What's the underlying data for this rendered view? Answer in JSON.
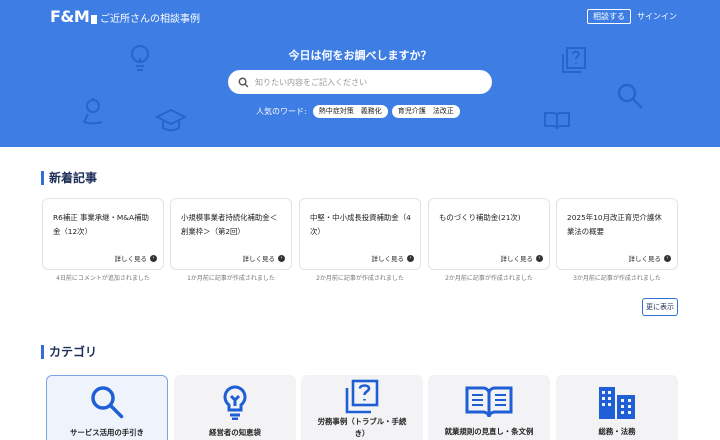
{
  "header": {
    "logo_text": "F&M",
    "site_title": "ご近所さんの相談事例",
    "consult_label": "相談する",
    "signin_label": "サインイン"
  },
  "hero": {
    "heading": "今日は何をお調べしますか？",
    "search_placeholder": "知りたい内容をご記入ください",
    "popular_label": "人気のワード:",
    "popular_tags": [
      "熱中症対策　義務化",
      "育児介護　法改正"
    ],
    "bg_color": "#3e7ee4"
  },
  "news": {
    "title": "新着記事",
    "more_label": "詳しく見る",
    "show_more_label": "更に表示",
    "articles": [
      {
        "title": "R6補正 事業承継・M&A補助金（12次）",
        "meta": "4日前にコメントが追加されました"
      },
      {
        "title": "小規模事業者持続化補助金＜創業枠＞（第2回）",
        "meta": "1か月前に記事が作成されました"
      },
      {
        "title": "中堅・中小成長投資補助金（4次）",
        "meta": "2か月前に記事が作成されました"
      },
      {
        "title": "ものづくり補助金(21次)",
        "meta": "2か月前に記事が作成されました"
      },
      {
        "title": "2025年10月改正育児介護休業法の概要",
        "meta": "3か月前に記事が作成されました"
      }
    ]
  },
  "categories": {
    "title": "カテゴリ",
    "accent_color": "#1f5fd6",
    "items": [
      {
        "label": "サービス活用の手引き",
        "icon": "search-icon"
      },
      {
        "label": "経営者の知恵袋",
        "icon": "lightbulb-icon"
      },
      {
        "label": "労務事例（トラブル・手続き）",
        "icon": "question-doc-icon"
      },
      {
        "label": "就業規則の見直し・条文例",
        "icon": "book-icon"
      },
      {
        "label": "総務・法務",
        "icon": "building-icon"
      }
    ]
  }
}
